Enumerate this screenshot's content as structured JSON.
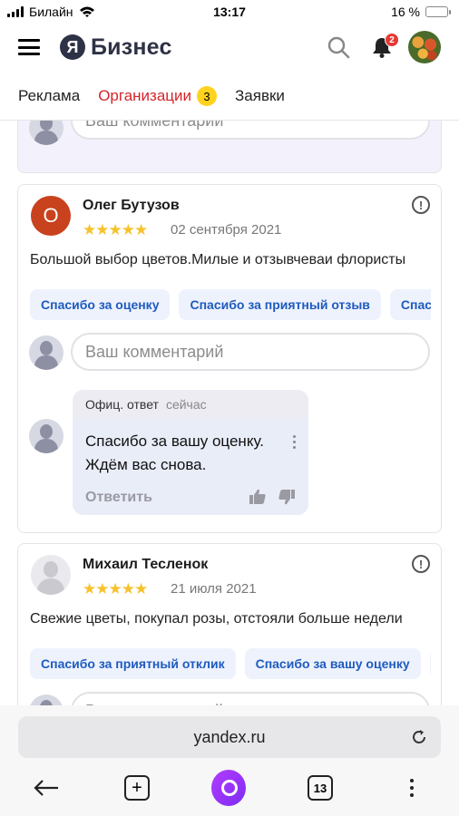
{
  "status_bar": {
    "carrier": "Билайн",
    "time": "13:17",
    "battery": "16 %",
    "battery_level": 0.16
  },
  "header": {
    "logo_mark": "Я",
    "logo_text": "Бизнес",
    "notifications_count": "2"
  },
  "tabs": [
    {
      "label": "Реклама",
      "active": false
    },
    {
      "label": "Организации",
      "active": true,
      "badge": "3"
    },
    {
      "label": "Заявки",
      "active": false
    }
  ],
  "comment_placeholder": "Ваш комментарий",
  "reviews": [
    {
      "avatar_letter": "О",
      "author": "Олег Бутузов",
      "rating": 5,
      "stars": "★★★★★",
      "date": "02 сентября 2021",
      "text": "Большой выбор цветов.Милые и отзывчеваи флористы",
      "chips": [
        "Спасибо за оценку",
        "Спасибо за приятный отзыв",
        "Спаси"
      ],
      "reply": {
        "label": "Офиц. ответ",
        "time": "сейчас",
        "text": "Спасибо за вашу оценку. Ждём вас снова.",
        "answer_label": "Ответить"
      }
    },
    {
      "author": "Михаил Тесленок",
      "rating": 5,
      "stars": "★★★★★",
      "date": "21 июля 2021",
      "text": "Свежие цветы, покупал розы, отстояли больше недели",
      "chips": [
        "Спасибо за приятный отклик",
        "Спасибо за вашу оценку",
        ""
      ]
    }
  ],
  "browser": {
    "url": "yandex.ru",
    "tabs_count": "13"
  },
  "colors": {
    "accent_red": "#d6242a",
    "chip_text": "#1e5bbf",
    "star": "#f6c22b",
    "alice": "#8a31f6"
  }
}
